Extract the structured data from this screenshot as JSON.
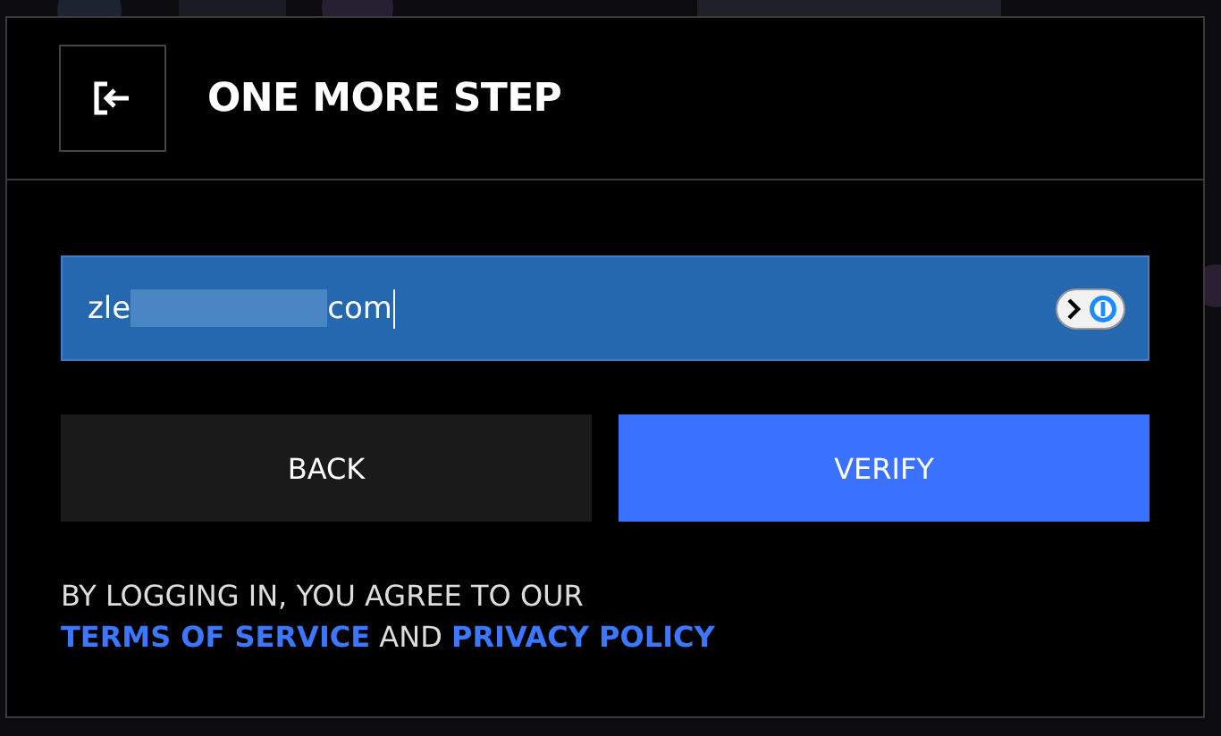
{
  "dialog": {
    "title": "ONE MORE STEP"
  },
  "email_field": {
    "value_start": "zle",
    "redacted": true,
    "value_end": "com",
    "focused": true
  },
  "buttons": [
    {
      "kind": "secondary",
      "label": "BACK"
    },
    {
      "kind": "primary",
      "label": "VERIFY"
    }
  ],
  "agreement": {
    "text": "BY LOGGING IN, YOU AGREE TO OUR",
    "link_1": "TERMS OF SERVICE",
    "conjunction": "AND",
    "link_2": "PRIVACY POLICY"
  }
}
